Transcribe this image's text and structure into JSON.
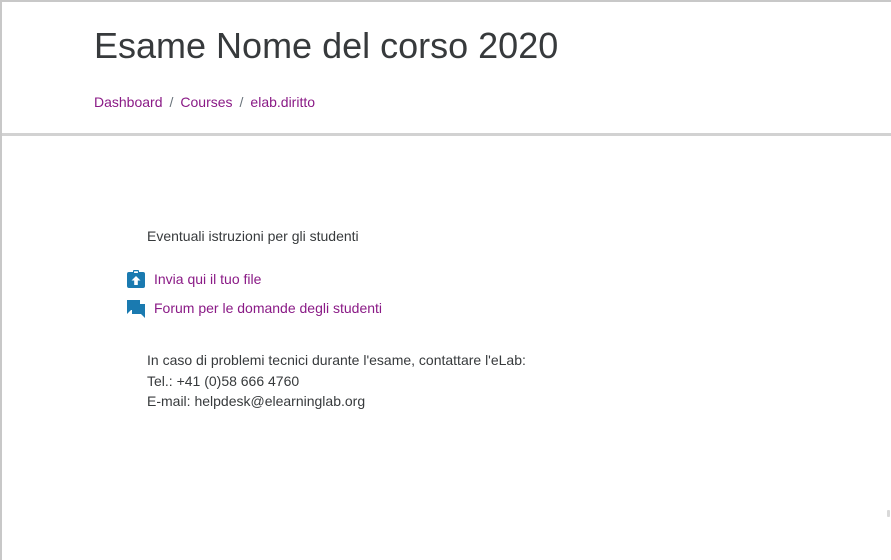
{
  "header": {
    "title": "Esame Nome del corso 2020",
    "breadcrumb": [
      {
        "label": "Dashboard"
      },
      {
        "label": "Courses"
      },
      {
        "label": "elab.diritto"
      }
    ],
    "separator": "/"
  },
  "content": {
    "intro_text": "Eventuali istruzioni per gli studenti",
    "activities": [
      {
        "label": "Invia qui il tuo file",
        "icon": "assignment-upload-icon"
      },
      {
        "label": "Forum per le domande degli studenti",
        "icon": "forum-icon"
      }
    ],
    "contact": {
      "line1": "In caso di problemi tecnici durante l'esame, contattare l'eLab:",
      "line2": "Tel.: +41 (0)58 666 4760",
      "line3": "E-mail: helpdesk@elearninglab.org"
    }
  },
  "colors": {
    "link": "#8a1a86",
    "text": "#373a3c",
    "icon_blue": "#1a7ab0",
    "divider": "#d2d2d2"
  }
}
